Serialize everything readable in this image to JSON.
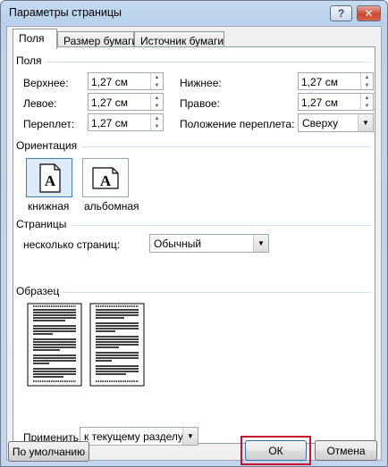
{
  "window": {
    "title": "Параметры страницы",
    "help_label": "?",
    "close_label": "✕"
  },
  "tabs": [
    {
      "label": "Поля"
    },
    {
      "label": "Размер бумаги"
    },
    {
      "label": "Источник бумаги"
    }
  ],
  "margins": {
    "group_label": "Поля",
    "top": {
      "label": "Верхнее:",
      "value": "1,27 см"
    },
    "bottom": {
      "label": "Нижнее:",
      "value": "1,27 см"
    },
    "left": {
      "label": "Левое:",
      "value": "1,27 см"
    },
    "right": {
      "label": "Правое:",
      "value": "1,27 см"
    },
    "gutter": {
      "label": "Переплет:",
      "value": "1,27 см"
    },
    "gutter_position": {
      "label": "Положение переплета:",
      "value": "Сверху"
    }
  },
  "orientation": {
    "group_label": "Ориентация",
    "portrait": {
      "label": "книжная",
      "icon": "portrait-page-icon",
      "selected": true
    },
    "landscape": {
      "label": "альбомная",
      "icon": "landscape-page-icon",
      "selected": false
    },
    "glyph": "A"
  },
  "pages": {
    "group_label": "Страницы",
    "multiple": {
      "label": "несколько страниц:",
      "value": "Обычный"
    }
  },
  "preview": {
    "group_label": "Образец"
  },
  "apply": {
    "label": "Применить:",
    "value": "к текущему разделу"
  },
  "buttons": {
    "default": "По умолчанию",
    "ok": "ОК",
    "cancel": "Отмена"
  },
  "colors": {
    "highlight": "#c8102e",
    "selected_bg": "#dcebfa"
  }
}
